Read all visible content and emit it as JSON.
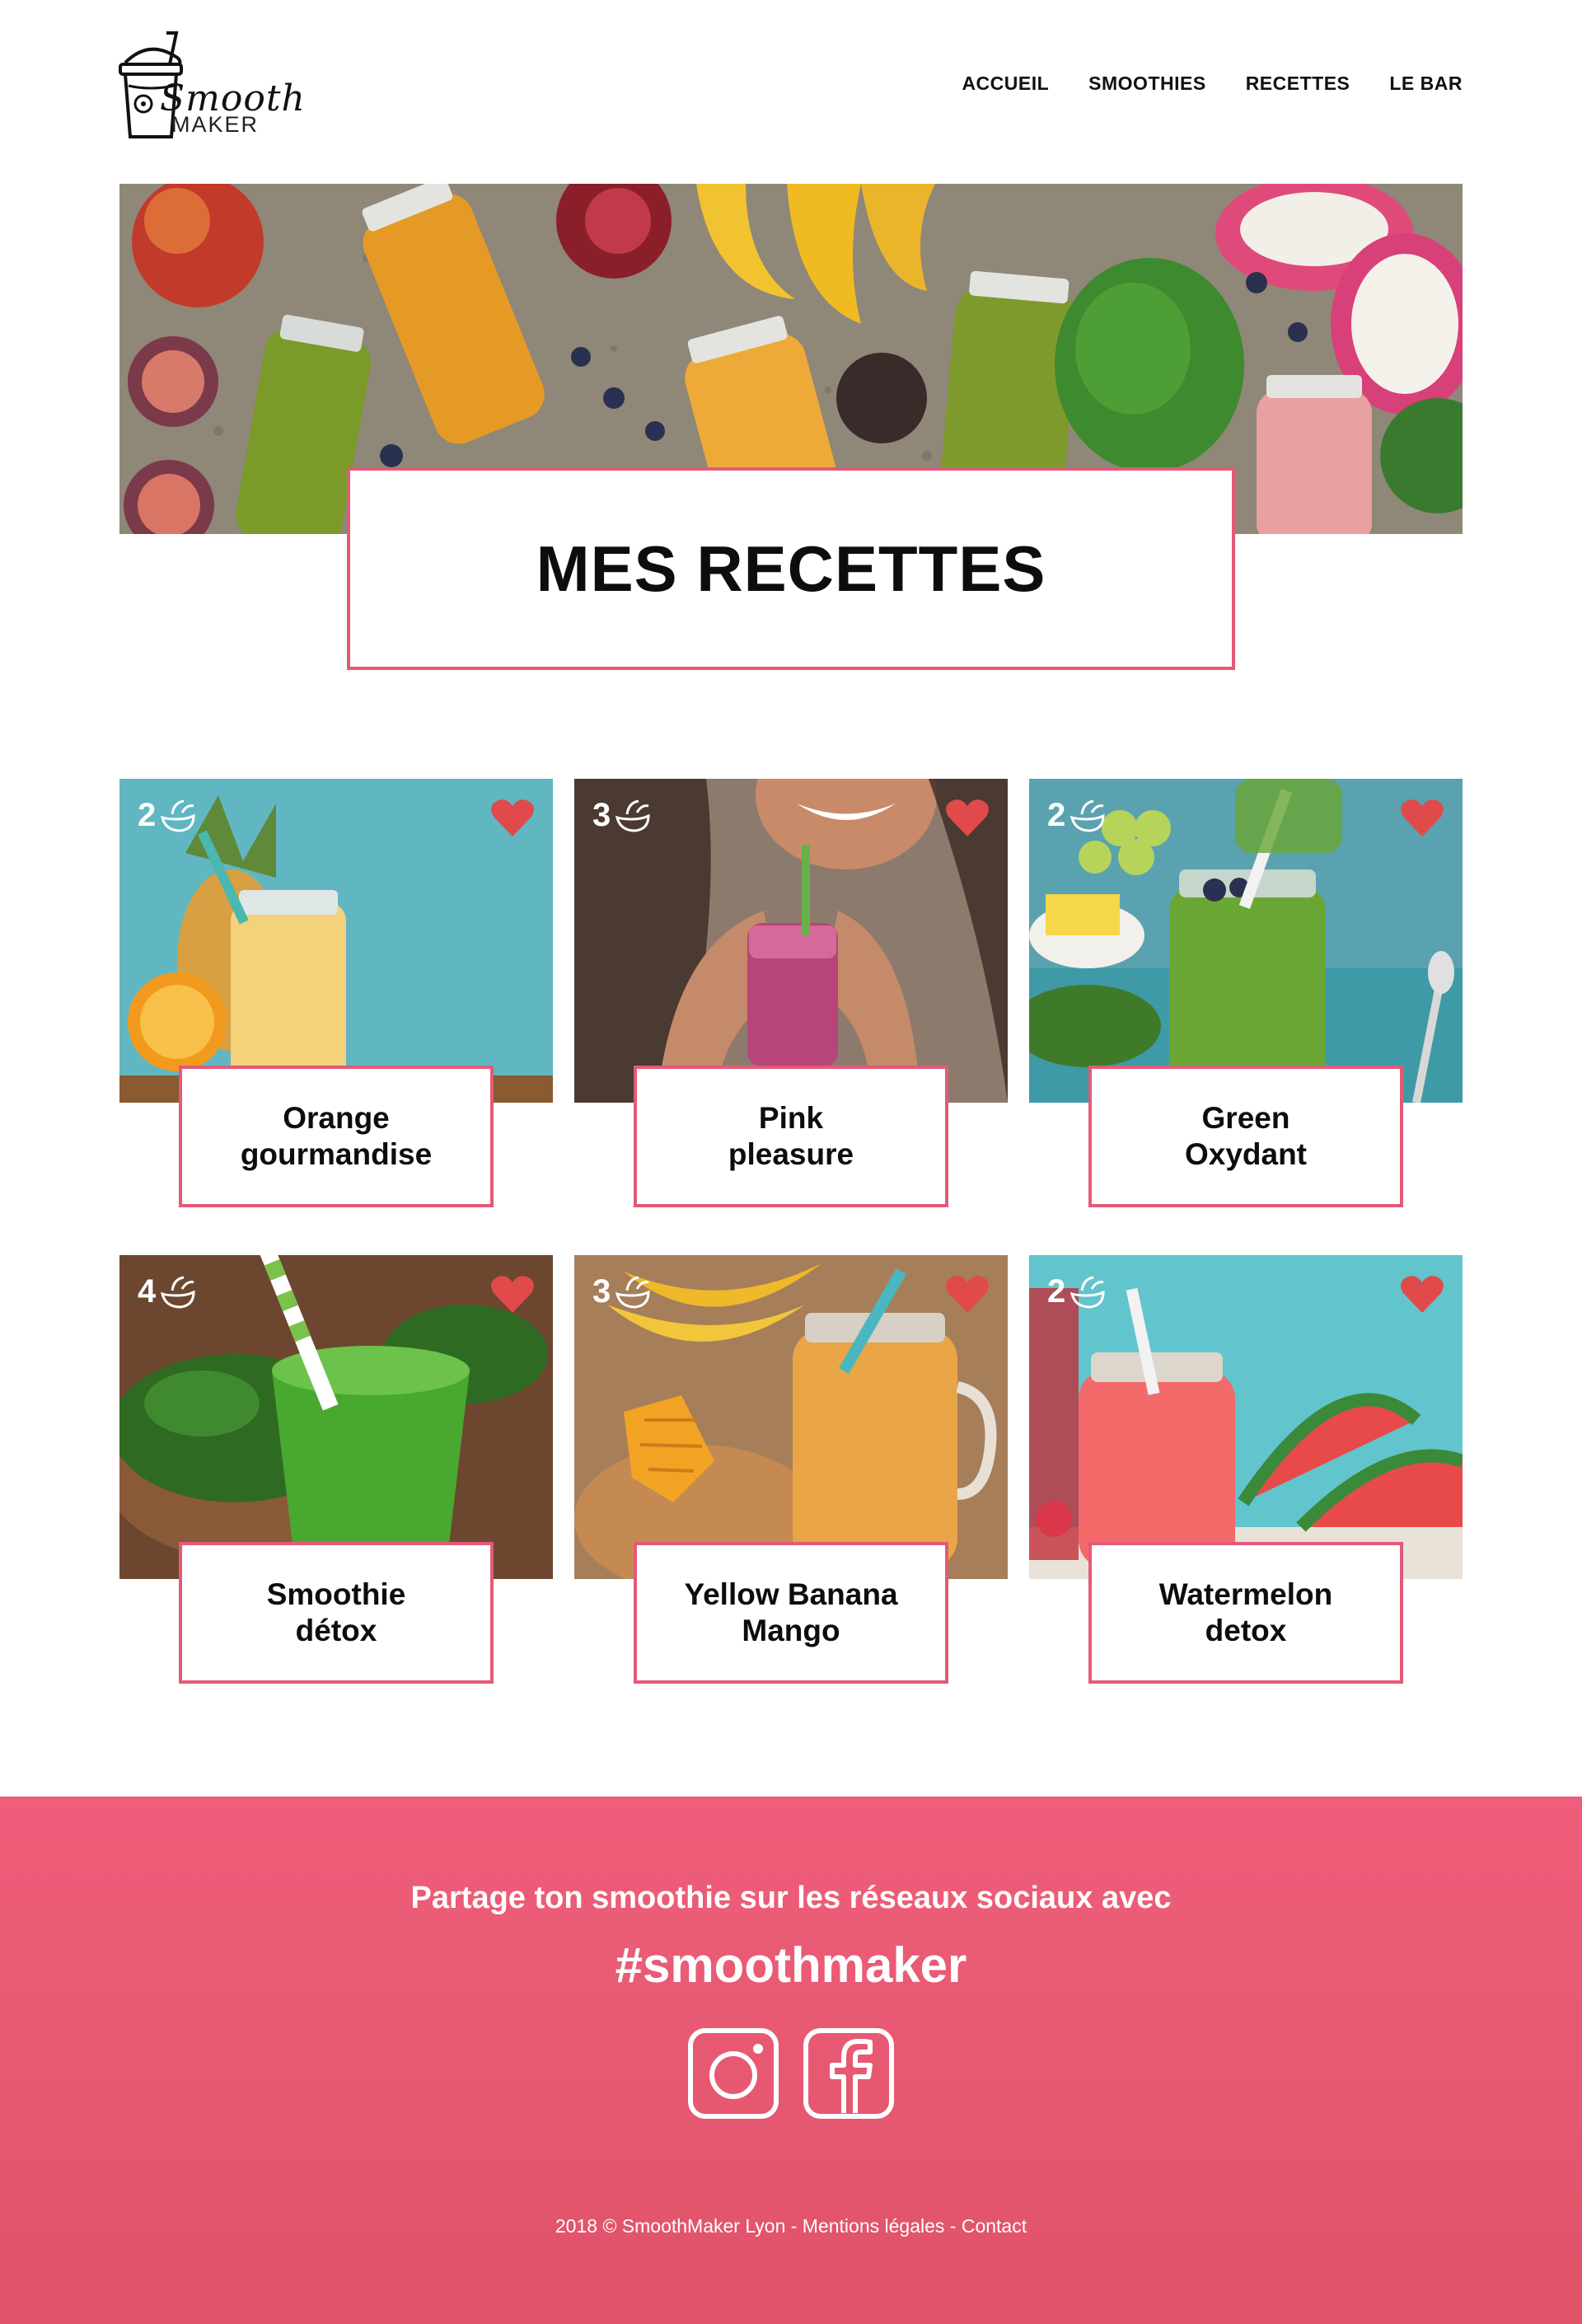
{
  "brand": {
    "script": "Smooth",
    "word": "MAKER",
    "logo_icon": "smoothie-cup-icon"
  },
  "nav": {
    "items": [
      {
        "label": "ACCUEIL"
      },
      {
        "label": "SMOOTHIES"
      },
      {
        "label": "RECETTES"
      },
      {
        "label": "LE BAR"
      }
    ]
  },
  "hero": {
    "title": "MES RECETTES"
  },
  "recipes": [
    {
      "name": "Orange\ngourmandise",
      "servings": "2",
      "favorite_icon": "heart-icon",
      "accent": "#f0c14a"
    },
    {
      "name": "Pink\npleasure",
      "servings": "3",
      "favorite_icon": "heart-icon",
      "accent": "#c94a86"
    },
    {
      "name": "Green\nOxydant",
      "servings": "2",
      "favorite_icon": "heart-icon",
      "accent": "#5aa33a"
    },
    {
      "name": "Smoothie\ndétox",
      "servings": "4",
      "favorite_icon": "heart-icon",
      "accent": "#49b23c"
    },
    {
      "name": "Yellow Banana\nMango",
      "servings": "3",
      "favorite_icon": "heart-icon",
      "accent": "#f2a43a"
    },
    {
      "name": "Watermelon\ndetox",
      "servings": "2",
      "favorite_icon": "heart-icon",
      "accent": "#f06a6a"
    }
  ],
  "footer": {
    "share_text": "Partage ton smoothie sur les réseaux sociaux avec",
    "hashtag": "#smoothmaker",
    "social": [
      {
        "name": "instagram-icon"
      },
      {
        "name": "facebook-icon"
      }
    ],
    "copyright": "2018 © SmoothMaker Lyon - Mentions légales - Contact"
  },
  "colors": {
    "accent_pink": "#e35a78",
    "heart_red": "#e04a4a",
    "footer_pink": "#ea5a74"
  }
}
